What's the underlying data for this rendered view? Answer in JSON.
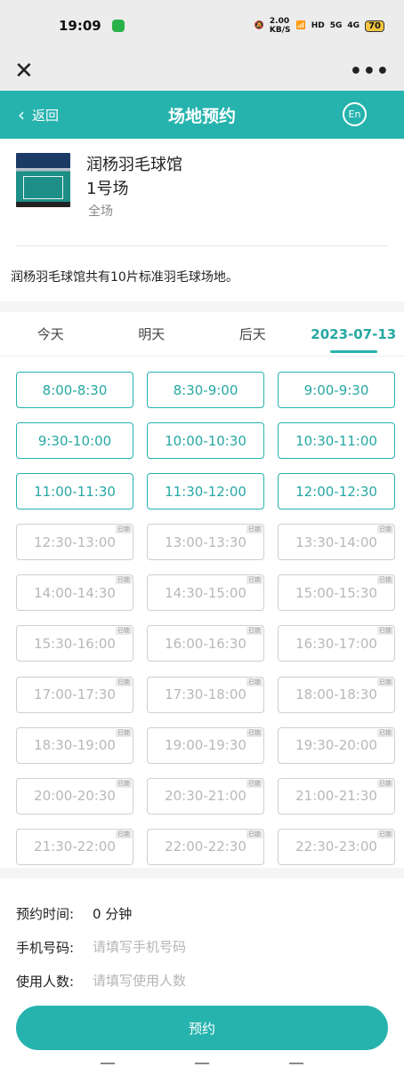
{
  "status_bar": {
    "time": "19:09",
    "network_speed": "2.00",
    "network_unit": "KB/S",
    "hd_label": "HD",
    "signal_5g": "5G",
    "signal_4g": "4G",
    "battery": "70"
  },
  "browser": {
    "close_icon": "close-icon",
    "more_icon": "more-icon"
  },
  "header": {
    "back_label": "返回",
    "title": "场地预约",
    "lang_label": "En"
  },
  "venue": {
    "name": "润杨羽毛球馆",
    "court": "1号场",
    "court_type": "全场",
    "description": "润杨羽毛球馆共有10片标准羽毛球场地。"
  },
  "tabs": [
    {
      "label": "今天",
      "active": false
    },
    {
      "label": "明天",
      "active": false
    },
    {
      "label": "后天",
      "active": false
    },
    {
      "label": "2023-07-13",
      "active": true
    }
  ],
  "slots": [
    {
      "label": "8:00-8:30",
      "available": true
    },
    {
      "label": "8:30-9:00",
      "available": true
    },
    {
      "label": "9:00-9:30",
      "available": true
    },
    {
      "label": "9:30-10:00",
      "available": true
    },
    {
      "label": "10:00-10:30",
      "available": true
    },
    {
      "label": "10:30-11:00",
      "available": true
    },
    {
      "label": "11:00-11:30",
      "available": true
    },
    {
      "label": "11:30-12:00",
      "available": true
    },
    {
      "label": "12:00-12:30",
      "available": true
    },
    {
      "label": "12:30-13:00",
      "available": false
    },
    {
      "label": "13:00-13:30",
      "available": false
    },
    {
      "label": "13:30-14:00",
      "available": false
    },
    {
      "label": "14:00-14:30",
      "available": false
    },
    {
      "label": "14:30-15:00",
      "available": false
    },
    {
      "label": "15:00-15:30",
      "available": false
    },
    {
      "label": "15:30-16:00",
      "available": false
    },
    {
      "label": "16:00-16:30",
      "available": false
    },
    {
      "label": "16:30-17:00",
      "available": false
    },
    {
      "label": "17:00-17:30",
      "available": false
    },
    {
      "label": "17:30-18:00",
      "available": false
    },
    {
      "label": "18:00-18:30",
      "available": false
    },
    {
      "label": "18:30-19:00",
      "available": false
    },
    {
      "label": "19:00-19:30",
      "available": false
    },
    {
      "label": "19:30-20:00",
      "available": false
    },
    {
      "label": "20:00-20:30",
      "available": false
    },
    {
      "label": "20:30-21:00",
      "available": false
    },
    {
      "label": "21:00-21:30",
      "available": false
    },
    {
      "label": "21:30-22:00",
      "available": false
    },
    {
      "label": "22:00-22:30",
      "available": false
    },
    {
      "label": "22:30-23:00",
      "available": false
    }
  ],
  "slot_tag": "已锁",
  "form": {
    "duration_label": "预约时间:",
    "duration_value": "0 分钟",
    "phone_label": "手机号码:",
    "phone_placeholder": "请填写手机号码",
    "people_label": "使用人数:",
    "people_placeholder": "请填写使用人数",
    "submit_label": "预约"
  },
  "colors": {
    "accent": "#26b3ae",
    "disabled": "#b8b8b8"
  }
}
